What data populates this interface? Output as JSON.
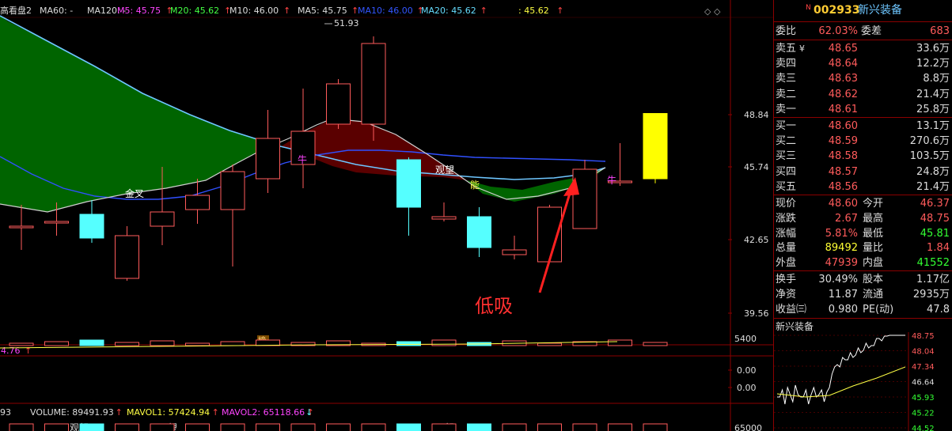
{
  "header": {
    "items": [
      {
        "text": "高看盘2",
        "color": "#dddddd"
      },
      {
        "text": "MA60: -",
        "color": "#dddddd"
      },
      {
        "text": "MA120: -",
        "color": "#dddddd"
      },
      {
        "text": "M5: 45.75",
        "color": "#ff44ff"
      },
      {
        "text": "M20: 45.62",
        "color": "#44ff44"
      },
      {
        "text": "M10: 46.00",
        "color": "#dddddd"
      },
      {
        "text": "MA5: 45.75",
        "color": "#dddddd"
      },
      {
        "text": "MA10: 46.00",
        "color": "#3355ff"
      },
      {
        "text": "MA20: 45.62",
        "color": "#66ddff"
      },
      {
        "text": ": 45.62",
        "color": "#ffff44"
      }
    ],
    "arrow": "↑",
    "diamond": "◇",
    "window_icons": "◇ ◇"
  },
  "chart_data": {
    "type": "candlestick",
    "price_axis": [
      "48.84",
      "45.74",
      "42.65",
      "39.56"
    ],
    "ylim": [
      39.0,
      52.8
    ],
    "annotations": {
      "high_label": "51.93",
      "golden_cross": "金叉",
      "niu1": "牛",
      "niu2": "牛",
      "guanwang": "观望",
      "neng": "能",
      "bang": "榜",
      "low_buy": "低吸"
    },
    "candles": [
      {
        "o": 44.0,
        "c": 44.0,
        "h": 44.9,
        "l": 43.0
      },
      {
        "o": 44.2,
        "c": 44.2,
        "h": 45.0,
        "l": 43.6
      },
      {
        "o": 44.5,
        "c": 43.5,
        "h": 45.1,
        "l": 43.3
      },
      {
        "o": 41.8,
        "c": 43.6,
        "h": 44.0,
        "l": 41.7
      },
      {
        "o": 44.0,
        "c": 44.6,
        "h": 46.5,
        "l": 43.2
      },
      {
        "o": 44.7,
        "c": 45.3,
        "h": 46.0,
        "l": 44.1
      },
      {
        "o": 44.7,
        "c": 46.3,
        "h": 46.6,
        "l": 42.3
      },
      {
        "o": 46.0,
        "c": 47.7,
        "h": 48.9,
        "l": 45.4
      },
      {
        "o": 46.6,
        "c": 48.0,
        "h": 49.8,
        "l": 45.6
      },
      {
        "o": 48.3,
        "c": 50.0,
        "h": 50.2,
        "l": 48.1
      },
      {
        "o": 48.3,
        "c": 51.7,
        "h": 52.0,
        "l": 47.6
      },
      {
        "o": 46.8,
        "c": 44.8,
        "h": 46.9,
        "l": 43.6
      },
      {
        "o": 44.3,
        "c": 44.4,
        "h": 45.0,
        "l": 44.2
      },
      {
        "o": 44.4,
        "c": 43.1,
        "h": 44.8,
        "l": 42.7
      },
      {
        "o": 42.8,
        "c": 43.0,
        "h": 43.6,
        "l": 42.6
      },
      {
        "o": 42.5,
        "c": 44.8,
        "h": 44.9,
        "l": 42.5
      },
      {
        "o": 43.9,
        "c": 46.4,
        "h": 46.8,
        "l": 43.9
      },
      {
        "o": 45.9,
        "c": 45.9,
        "h": 47.5,
        "l": 45.7
      },
      {
        "o": 46.0,
        "c": 48.75,
        "h": 48.75,
        "l": 45.81
      }
    ]
  },
  "volume_panel": {
    "left_label": "4.76",
    "axis": [
      "5400"
    ]
  },
  "macd_panel": {
    "axis": [
      "0.00",
      "0.00"
    ]
  },
  "bottom_panel": {
    "items": [
      {
        "text": "93",
        "color": "#dddddd"
      },
      {
        "text": "VOLUME: 89491.93",
        "color": "#dddddd"
      },
      {
        "text": "MAVOL1: 57424.94",
        "color": "#ffff44"
      },
      {
        "text": "MAVOL2: 65118.66",
        "color": "#ff44ff"
      }
    ],
    "labels": [
      "观望",
      "观望",
      "观望"
    ],
    "axis": "65000"
  },
  "quote": {
    "badge": "N",
    "code": "002933",
    "name": "新兴装备",
    "weibi_label": "委比",
    "weibi_value": "62.03%",
    "weicha_label": "委差",
    "weicha_value": "683",
    "currency": "¥",
    "asks": [
      {
        "label": "卖五",
        "price": "48.65",
        "vol": "33.6万"
      },
      {
        "label": "卖四",
        "price": "48.64",
        "vol": "12.2万"
      },
      {
        "label": "卖三",
        "price": "48.63",
        "vol": "8.8万"
      },
      {
        "label": "卖二",
        "price": "48.62",
        "vol": "21.4万"
      },
      {
        "label": "卖一",
        "price": "48.61",
        "vol": "25.8万"
      }
    ],
    "bids": [
      {
        "label": "买一",
        "price": "48.60",
        "vol": "13.1万"
      },
      {
        "label": "买二",
        "price": "48.59",
        "vol": "270.6万"
      },
      {
        "label": "买三",
        "price": "48.58",
        "vol": "103.5万"
      },
      {
        "label": "买四",
        "price": "48.57",
        "vol": "24.8万"
      },
      {
        "label": "买五",
        "price": "48.56",
        "vol": "21.4万"
      }
    ],
    "stats": [
      {
        "l1": "现价",
        "v1": "48.60",
        "c1": "red",
        "l2": "今开",
        "v2": "46.37",
        "c2": "red"
      },
      {
        "l1": "涨跌",
        "v1": "2.67",
        "c1": "red",
        "l2": "最高",
        "v2": "48.75",
        "c2": "red"
      },
      {
        "l1": "涨幅",
        "v1": "5.81%",
        "c1": "red",
        "l2": "最低",
        "v2": "45.81",
        "c2": "green"
      },
      {
        "l1": "总量",
        "v1": "89492",
        "c1": "yel",
        "l2": "量比",
        "v2": "1.84",
        "c2": "red"
      },
      {
        "l1": "外盘",
        "v1": "47939",
        "c1": "red",
        "l2": "内盘",
        "v2": "41552",
        "c2": "green"
      }
    ],
    "fundamentals": [
      {
        "l1": "换手",
        "v1": "30.49%",
        "l2": "股本",
        "v2": "1.17亿"
      },
      {
        "l1": "净资",
        "v1": "11.87",
        "l2": "流通",
        "v2": "2935万"
      },
      {
        "l1": "收益㈢",
        "v1": "0.980",
        "l2": "PE(动)",
        "v2": "47.8"
      }
    ],
    "mini_title": "新兴装备",
    "mini_axis": [
      "48.75",
      "48.04",
      "47.34",
      "46.64",
      "45.93",
      "45.22",
      "44.52"
    ]
  },
  "colors": {
    "up": "#ff5b5b",
    "down": "#55ffff",
    "grid": "#8b0000",
    "bull_fill": "#006400",
    "bear_fill": "#5a0000"
  }
}
